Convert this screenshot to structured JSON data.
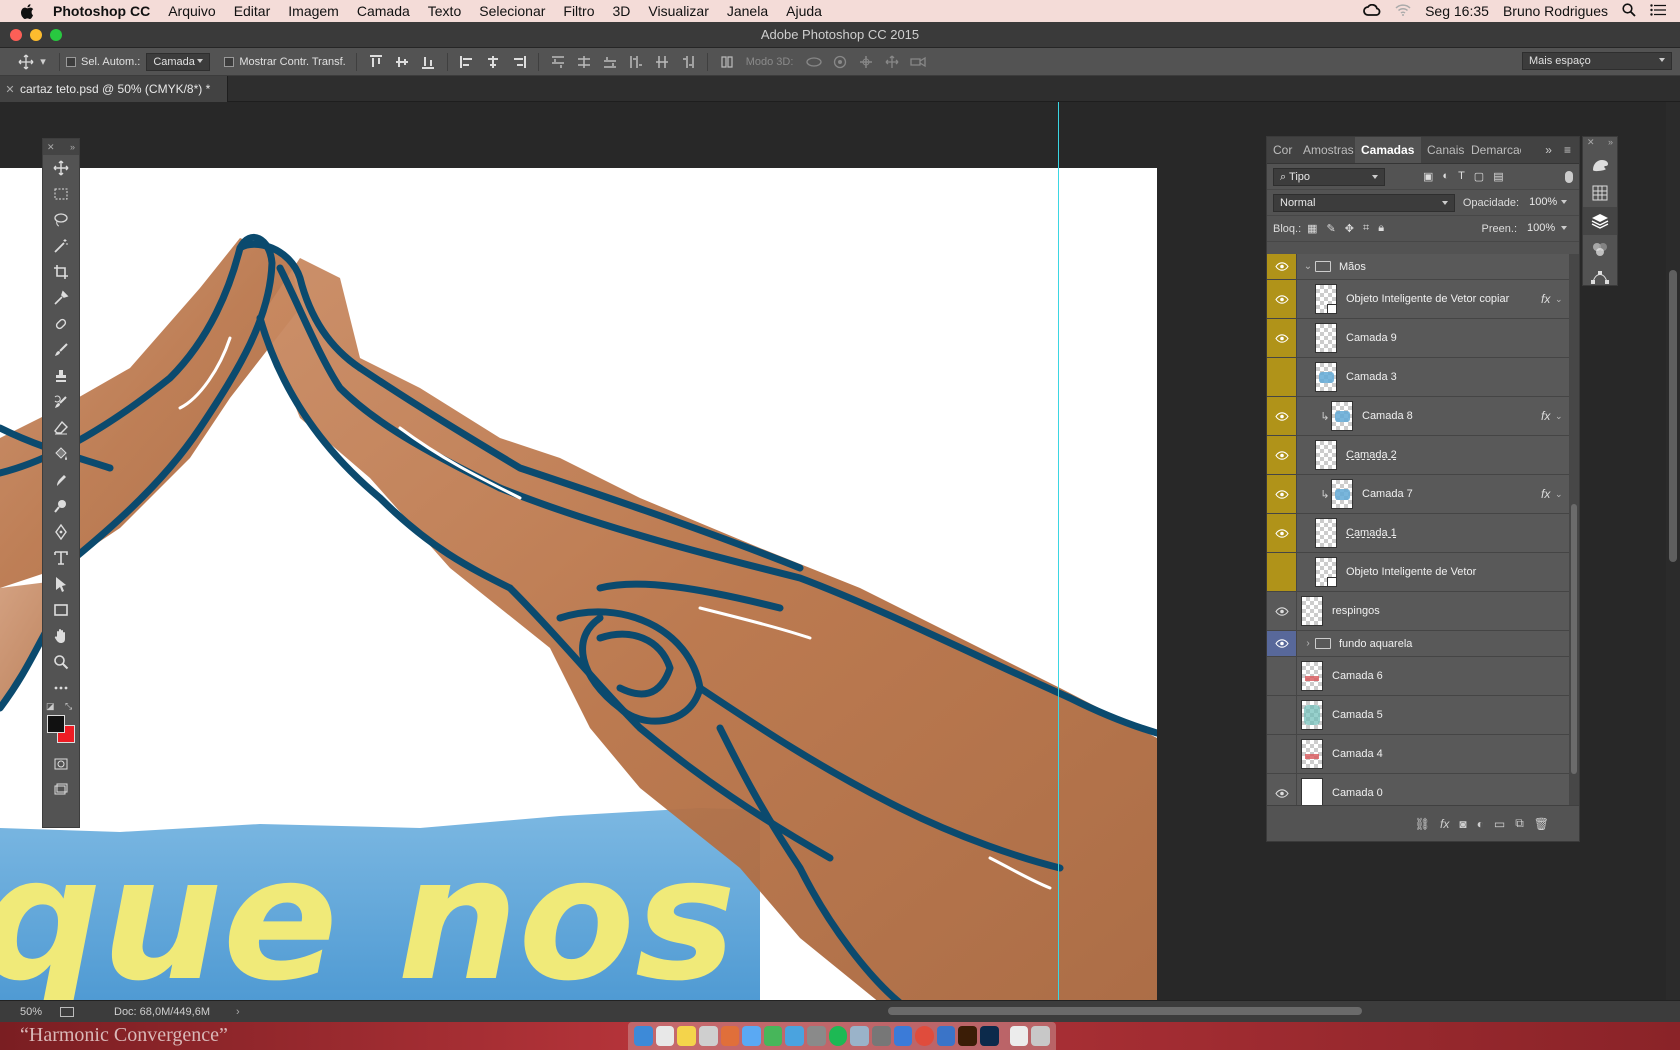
{
  "menubar": {
    "app_name": "Photoshop CC",
    "items": [
      "Arquivo",
      "Editar",
      "Imagem",
      "Camada",
      "Texto",
      "Selecionar",
      "Filtro",
      "3D",
      "Visualizar",
      "Janela",
      "Ajuda"
    ],
    "clock": "Seg 16:35",
    "user": "Bruno Rodrigues"
  },
  "window": {
    "title": "Adobe Photoshop CC 2015"
  },
  "options": {
    "auto_select_label": "Sel. Autom.:",
    "auto_select_value": "Camada",
    "show_transform_label": "Mostrar Contr. Transf.",
    "mode_3d_label": "Modo 3D:",
    "workspace": "Mais espaço"
  },
  "document": {
    "tab_title": "cartaz teto.psd @ 50% (CMYK/8*) *"
  },
  "status": {
    "zoom": "50%",
    "doc_size": "Doc: 68,0M/449,6M"
  },
  "desktop": {
    "wallpaper_title": "“Harmonic Convergence”"
  },
  "artwork": {
    "lettering": "que nos"
  },
  "layers_panel": {
    "tabs": [
      "Cor",
      "Amostras",
      "Camadas",
      "Canais",
      "Demarcações"
    ],
    "active_tab": "Camadas",
    "filter_kind": "Tipo",
    "blend_mode": "Normal",
    "opacity_label": "Opacidade:",
    "opacity_value": "100%",
    "lock_label": "Bloq.:",
    "fill_label": "Preen.:",
    "fill_value": "100%",
    "layers": [
      {
        "name": "Mãos",
        "kind": "group",
        "visible": true,
        "color": "gold",
        "indent": 0,
        "expanded": true
      },
      {
        "name": "Objeto Inteligente de Vetor copiar",
        "kind": "smart",
        "visible": true,
        "color": "gold",
        "indent": 1,
        "fx": true
      },
      {
        "name": "Camada 9",
        "kind": "layer",
        "visible": true,
        "color": "gold",
        "indent": 1
      },
      {
        "name": "Camada 3",
        "kind": "layer",
        "visible": false,
        "color": "gold",
        "indent": 1,
        "thumb": "blue"
      },
      {
        "name": "Camada 8",
        "kind": "layer",
        "visible": true,
        "color": "gold",
        "indent": 1,
        "clipped": true,
        "fx": true,
        "thumb": "blue"
      },
      {
        "name": "Camada 2",
        "kind": "layer",
        "visible": true,
        "color": "gold",
        "indent": 1,
        "strike": true
      },
      {
        "name": "Camada 7",
        "kind": "layer",
        "visible": true,
        "color": "gold",
        "indent": 1,
        "clipped": true,
        "fx": true,
        "thumb": "blue"
      },
      {
        "name": "Camada 1",
        "kind": "layer",
        "visible": true,
        "color": "gold",
        "indent": 1,
        "strike": true
      },
      {
        "name": "Objeto Inteligente de Vetor",
        "kind": "smart",
        "visible": false,
        "color": "gold",
        "indent": 1
      },
      {
        "name": "respingos",
        "kind": "layer",
        "visible": true,
        "color": "none",
        "indent": 0
      },
      {
        "name": "fundo aquarela",
        "kind": "group",
        "visible": true,
        "color": "blue",
        "indent": 0,
        "expanded": false
      },
      {
        "name": "Camada 6",
        "kind": "layer",
        "visible": false,
        "color": "none",
        "indent": 0,
        "thumb": "red"
      },
      {
        "name": "Camada 5",
        "kind": "layer",
        "visible": false,
        "color": "none",
        "indent": 0,
        "thumb": "teal"
      },
      {
        "name": "Camada 4",
        "kind": "layer",
        "visible": false,
        "color": "none",
        "indent": 0,
        "thumb": "red"
      },
      {
        "name": "Camada 0",
        "kind": "layer",
        "visible": true,
        "color": "none",
        "indent": 0,
        "thumb": "white"
      }
    ]
  }
}
